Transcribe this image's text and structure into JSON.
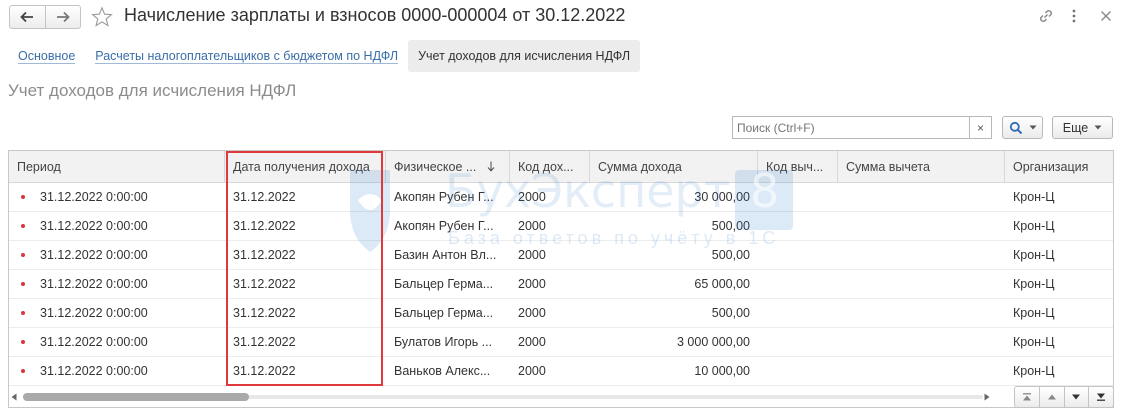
{
  "window": {
    "title": "Начисление зарплаты и взносов 0000-000004 от 30.12.2022"
  },
  "tabs": [
    {
      "label": "Основное",
      "active": false
    },
    {
      "label": "Расчеты налогоплательщиков с бюджетом по НДФЛ",
      "active": false
    },
    {
      "label": "Учет доходов для исчисления НДФЛ",
      "active": true
    }
  ],
  "section": {
    "title": "Учет доходов для исчисления НДФЛ"
  },
  "toolbar": {
    "search_placeholder": "Поиск (Ctrl+F)",
    "clear_label": "×",
    "more_label": "Еще"
  },
  "table": {
    "columns": [
      "Период",
      "Дата получения дохода",
      "Физическое ...",
      "Код дох...",
      "Сумма дохода",
      "Код выч...",
      "Сумма вычета",
      "Организация"
    ],
    "rows": [
      {
        "period": "31.12.2022 0:00:00",
        "date": "31.12.2022",
        "person": "Акопян Рубен Г...",
        "code": "2000",
        "amount": "30 000,00",
        "ded_code": "",
        "ded_amount": "",
        "org": "Крон-Ц"
      },
      {
        "period": "31.12.2022 0:00:00",
        "date": "31.12.2022",
        "person": "Акопян Рубен Г...",
        "code": "2000",
        "amount": "500,00",
        "ded_code": "",
        "ded_amount": "",
        "org": "Крон-Ц"
      },
      {
        "period": "31.12.2022 0:00:00",
        "date": "31.12.2022",
        "person": "Базин Антон Вл...",
        "code": "2000",
        "amount": "500,00",
        "ded_code": "",
        "ded_amount": "",
        "org": "Крон-Ц"
      },
      {
        "period": "31.12.2022 0:00:00",
        "date": "31.12.2022",
        "person": "Бальцер Герма...",
        "code": "2000",
        "amount": "65 000,00",
        "ded_code": "",
        "ded_amount": "",
        "org": "Крон-Ц"
      },
      {
        "period": "31.12.2022 0:00:00",
        "date": "31.12.2022",
        "person": "Бальцер Герма...",
        "code": "2000",
        "amount": "500,00",
        "ded_code": "",
        "ded_amount": "",
        "org": "Крон-Ц"
      },
      {
        "period": "31.12.2022 0:00:00",
        "date": "31.12.2022",
        "person": "Булатов Игорь ...",
        "code": "2000",
        "amount": "3 000 000,00",
        "ded_code": "",
        "ded_amount": "",
        "org": "Крон-Ц"
      },
      {
        "period": "31.12.2022 0:00:00",
        "date": "31.12.2022",
        "person": "Ваньков Алекс...",
        "code": "2000",
        "amount": "10 000,00",
        "ded_code": "",
        "ded_amount": "",
        "org": "Крон-Ц"
      }
    ]
  },
  "watermark": {
    "brand": "БухЭксперт",
    "number": "8",
    "tagline": "База ответов по учёту в 1С"
  },
  "colors": {
    "link": "#3a6ea8",
    "highlight": "#e0393b",
    "row_marker": "#d9363e",
    "watermark": "#2e7bd1"
  },
  "icons": {
    "back": "arrow-left-icon",
    "forward": "arrow-right-icon",
    "favorite": "star-icon",
    "link": "link-icon",
    "menu": "more-vertical-icon",
    "close": "close-icon",
    "search": "magnifier-icon",
    "scroll_left": "triangle-left-icon",
    "scroll_right": "triangle-right-icon",
    "first": "first-page-icon",
    "prev": "prev-page-icon",
    "next": "next-page-icon",
    "last": "last-page-icon"
  }
}
